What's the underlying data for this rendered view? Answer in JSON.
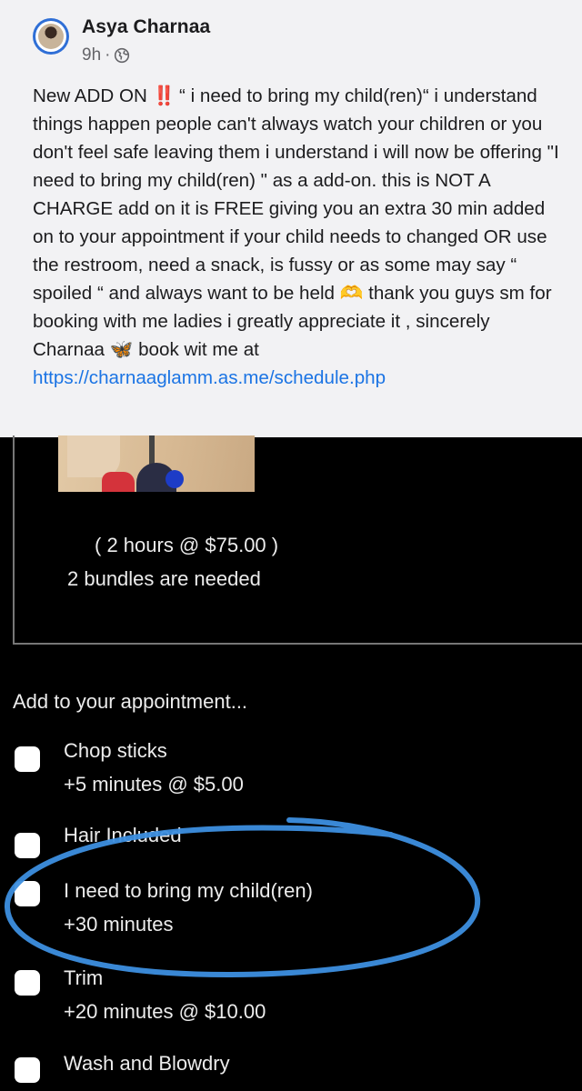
{
  "post": {
    "author": "Asya Charnaa",
    "time": "9h",
    "separator": "·",
    "icons": {
      "avatar": "profile-photo",
      "privacy": "globe-icon",
      "emphasis": "double-exclamation-emoji",
      "hands": "heart-hands-emoji",
      "butterfly": "butterfly-emoji"
    },
    "text_1": "New ADD ON ",
    "emoji_bang": "‼️",
    "text_2": " “ i need to bring my child(ren)“ i understand things happen people can't always watch your children or you don't feel safe leaving them i understand i will now be offering \"I need to bring my child(ren) \" as a add-on. this is NOT A CHARGE add on it is FREE giving you an extra 30 min added on to your appointment if your child needs to changed OR use the restroom, need a snack, is fussy or as some may say “ spoiled “ and always want to be held ",
    "emoji_hands": "🫶",
    "text_3": " thank you guys sm for booking with me ladies i greatly appreciate it , sincerely Charnaa ",
    "emoji_butterfly": "🦋",
    "text_4": " book wit me at ",
    "link": "https://charnaaglamm.as.me/schedule.php"
  },
  "booking": {
    "service_duration": "( 2 hours @ $75.00 )",
    "service_note": "2 bundles are needed",
    "addons_title": "Add to your appointment...",
    "addons": [
      {
        "name": "Chop sticks",
        "detail": "+5 minutes @ $5.00",
        "checked": false
      },
      {
        "name": "Hair Included",
        "detail": "",
        "checked": false
      },
      {
        "name": "I need to bring my child(ren)",
        "detail": "+30 minutes",
        "checked": false
      },
      {
        "name": "Trim",
        "detail": "+20 minutes @ $10.00",
        "checked": false
      },
      {
        "name": "Wash and Blowdry",
        "detail": "",
        "checked": false
      }
    ],
    "highlight_color": "#3d8fe0"
  }
}
